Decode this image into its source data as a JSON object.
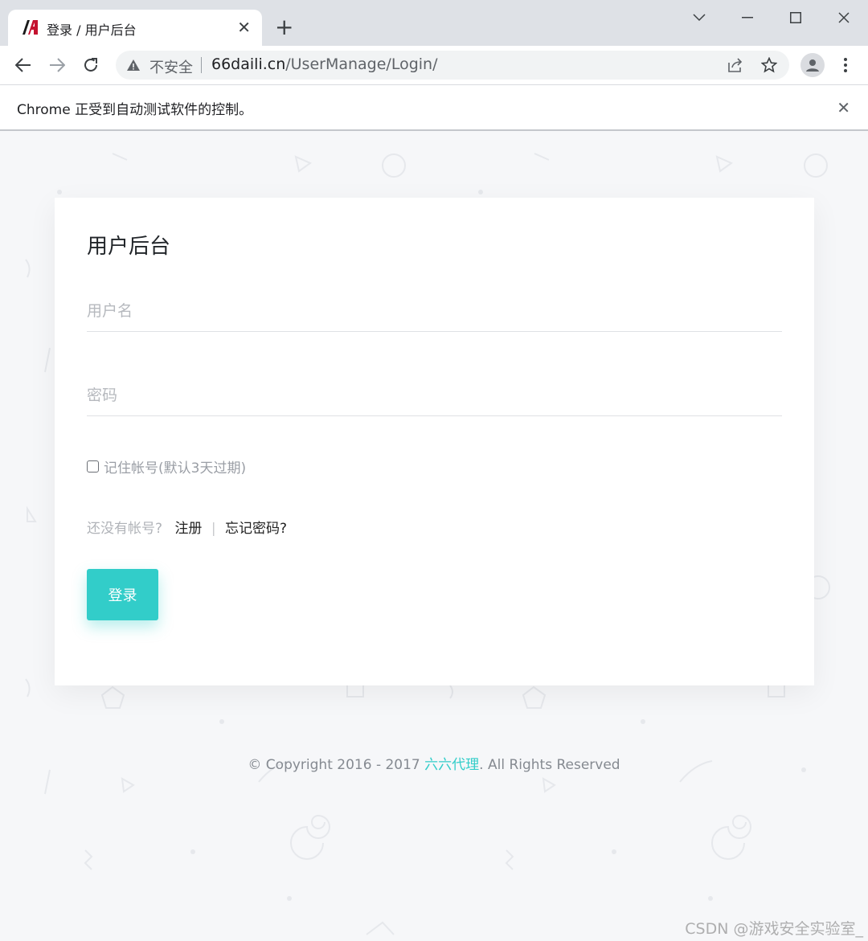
{
  "browser": {
    "tab_title": "登录 / 用户后台",
    "tab_close": "✕",
    "new_tab": "+",
    "url_security": "不安全",
    "url_host": "66daili.cn",
    "url_path": "/UserManage/Login/",
    "infobar_text": "Chrome 正受到自动测试软件的控制。",
    "infobar_close": "✕"
  },
  "login": {
    "title": "用户后台",
    "username_placeholder": "用户名",
    "password_placeholder": "密码",
    "remember_label": "记住帐号(默认3天过期)",
    "no_account_text": "还没有帐号?",
    "register_link": "注册",
    "separator": "|",
    "forgot_link": "忘记密码?",
    "submit_label": "登录"
  },
  "footer": {
    "prefix": "© Copyright 2016 - 2017 ",
    "brand": "六六代理",
    "suffix": ". All Rights Reserved"
  },
  "watermark": "CSDN @游戏安全实验室_",
  "colors": {
    "accent": "#32cdc9",
    "tabstrip": "#dee1e6",
    "page_bg": "#f6f7f9"
  },
  "icons": {
    "favicon": "site-logo-icon",
    "back": "back-arrow-icon",
    "forward": "forward-arrow-icon",
    "reload": "reload-icon",
    "security": "warning-triangle-icon",
    "share": "share-icon",
    "bookmark": "star-icon",
    "profile": "profile-icon",
    "menu": "menu-dots-icon"
  }
}
